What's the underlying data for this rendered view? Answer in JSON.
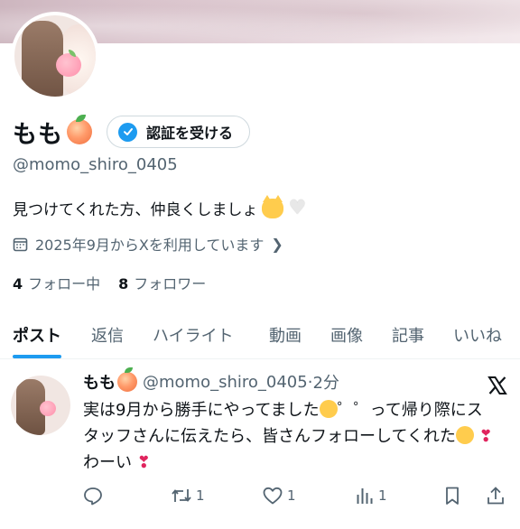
{
  "profile": {
    "name": "もも",
    "verify_button": "認証を受ける",
    "handle": "@momo_shiro_0405",
    "bio": "見つけてくれた方、仲良くしましょ",
    "joined": "2025年9月からXを利用しています",
    "following_count": "4",
    "following_label": "フォロー中",
    "followers_count": "8",
    "followers_label": "フォロワー"
  },
  "tabs": [
    "ポスト",
    "返信",
    "ハイライト",
    "動画",
    "画像",
    "記事",
    "いいね"
  ],
  "post": {
    "author": "もも",
    "handle": "@momo_shiro_0405",
    "separator": "·",
    "time": "2分",
    "text_part1": "実は9月から勝手にやってました",
    "text_part2": "゜゜って帰り際にスタッフさんに伝えたら、皆さんフォローしてくれた",
    "text_part3": "わーい",
    "exclaim": "❣",
    "replies": "",
    "reposts": "1",
    "likes": "1",
    "views": "1"
  },
  "colors": {
    "accent": "#1d9bf0",
    "muted": "#536471",
    "text": "#0f1419"
  }
}
